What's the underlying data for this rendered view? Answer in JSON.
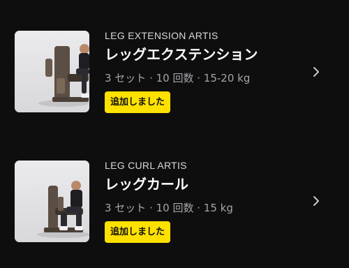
{
  "exercises": [
    {
      "category": "LEG EXTENSION ARTIS",
      "name": "レッグエクステンション",
      "summary": "3 セット · 10 回数 · 15-20 kg",
      "status_label": "追加しました",
      "thumbnail_icon": "leg-extension-machine-photo",
      "chevron_icon": "chevron-right-icon"
    },
    {
      "category": "LEG CURL ARTIS",
      "name": "レッグカール",
      "summary": "3 セット · 10 回数 · 15 kg",
      "status_label": "追加しました",
      "thumbnail_icon": "leg-curl-machine-photo",
      "chevron_icon": "chevron-right-icon"
    }
  ],
  "colors": {
    "background": "#0e0e0f",
    "accent": "#ffe100",
    "meta_text": "#a5a5a8"
  }
}
